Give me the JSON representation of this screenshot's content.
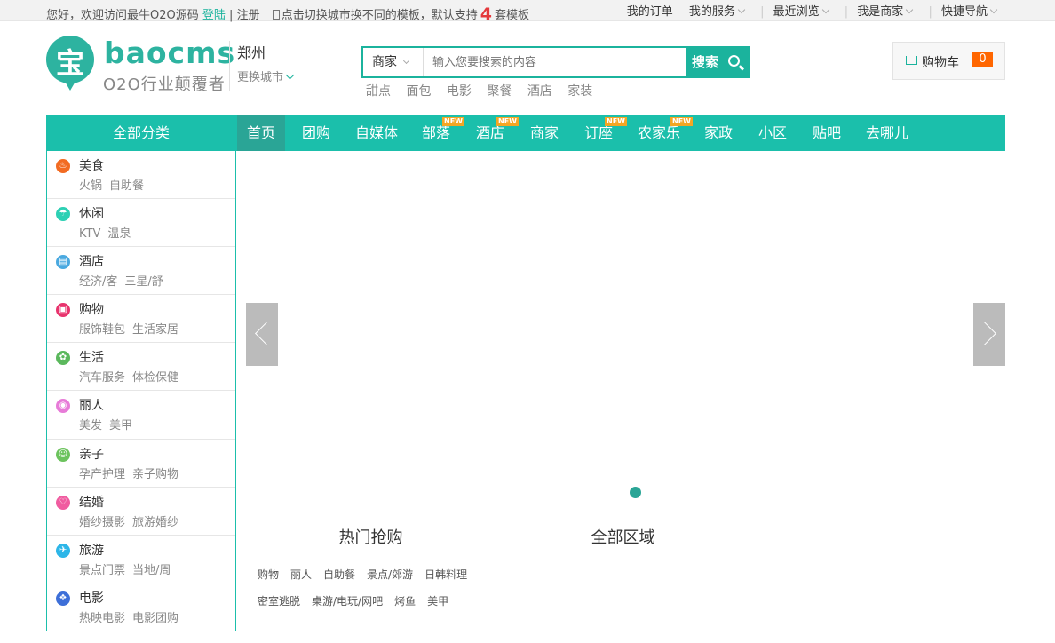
{
  "topbar": {
    "welcome": "您好，欢迎访问最牛O2O源码",
    "login": "登陆",
    "separator": "|",
    "register": "注册",
    "template_tip": "点击切换城市换不同的模板，默认支持",
    "template_count": "4",
    "template_suffix": "套模板",
    "links": [
      "我的订单",
      "我的服务",
      "最近浏览",
      "我是商家",
      "快捷导航"
    ]
  },
  "logo": {
    "glyph": "宝",
    "name": "baocms",
    "slogan": "O2O行业颠覆者"
  },
  "city": {
    "current": "郑州",
    "change": "更换城市"
  },
  "search": {
    "type": "商家",
    "placeholder": "输入您要搜索的内容",
    "button": "搜索",
    "hotwords": [
      "甜点",
      "面包",
      "电影",
      "聚餐",
      "酒店",
      "家装"
    ]
  },
  "cart": {
    "label": "购物车",
    "count": "0"
  },
  "nav": {
    "all": "全部分类",
    "items": [
      {
        "label": "首页",
        "new": ""
      },
      {
        "label": "团购",
        "new": ""
      },
      {
        "label": "自媒体",
        "new": ""
      },
      {
        "label": "部落",
        "new": "NEW"
      },
      {
        "label": "酒店",
        "new": "NEW"
      },
      {
        "label": "商家",
        "new": ""
      },
      {
        "label": "订座",
        "new": "NEW"
      },
      {
        "label": "农家乐",
        "new": "NEW"
      },
      {
        "label": "家政",
        "new": ""
      },
      {
        "label": "小区",
        "new": ""
      },
      {
        "label": "贴吧",
        "new": ""
      },
      {
        "label": "去哪儿",
        "new": ""
      }
    ]
  },
  "categories": [
    {
      "title": "美食",
      "subs": [
        "火锅",
        "自助餐"
      ],
      "icon": "food-icon",
      "color": "#f26b22"
    },
    {
      "title": "休闲",
      "subs": [
        "KTV",
        "温泉"
      ],
      "icon": "leisure-icon",
      "color": "#2dd0b4"
    },
    {
      "title": "酒店",
      "subs": [
        "经济/客",
        "三星/舒"
      ],
      "icon": "hotel-icon",
      "color": "#4aa9e0"
    },
    {
      "title": "购物",
      "subs": [
        "服饰鞋包",
        "生活家居"
      ],
      "icon": "shopping-icon",
      "color": "#e8336d"
    },
    {
      "title": "生活",
      "subs": [
        "汽车服务",
        "体检保健"
      ],
      "icon": "life-icon",
      "color": "#5bb85d"
    },
    {
      "title": "丽人",
      "subs": [
        "美发",
        "美甲"
      ],
      "icon": "beauty-icon",
      "color": "#e77bd8"
    },
    {
      "title": "亲子",
      "subs": [
        "孕产护理",
        "亲子购物"
      ],
      "icon": "family-icon",
      "color": "#6cc35d"
    },
    {
      "title": "结婚",
      "subs": [
        "婚纱摄影",
        "旅游婚纱"
      ],
      "icon": "wedding-icon",
      "color": "#f05ca0"
    },
    {
      "title": "旅游",
      "subs": [
        "景点门票",
        "当地/周"
      ],
      "icon": "travel-icon",
      "color": "#2db6e8"
    },
    {
      "title": "电影",
      "subs": [
        "热映电影",
        "电影团购"
      ],
      "icon": "movie-icon",
      "color": "#3d6fd8"
    }
  ],
  "hot": {
    "title": "热门抢购",
    "items": [
      "购物",
      "丽人",
      "自助餐",
      "景点/郊游",
      "日韩料理",
      "密室逃脱",
      "桌游/电玩/网吧",
      "烤鱼",
      "美甲"
    ]
  },
  "area": {
    "title": "全部区域"
  },
  "colors": {
    "brand": "#1bbfab",
    "new_badge": "#f5a623",
    "cart_count": "#ff6600"
  }
}
